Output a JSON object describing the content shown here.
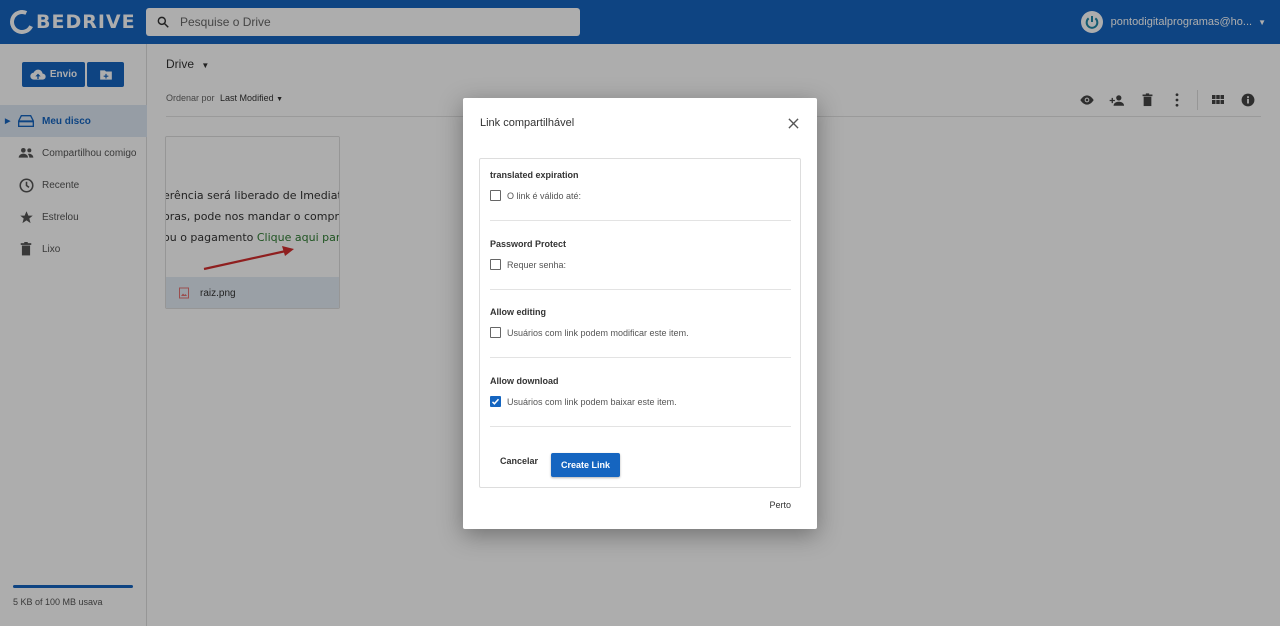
{
  "brand": {
    "name": "BEDRIVE",
    "accent": "#1565c0"
  },
  "search": {
    "placeholder": "Pesquise o Drive"
  },
  "account": {
    "email": "pontodigitalprogramas@ho..."
  },
  "sidebar": {
    "upload_label": "Envio",
    "items": [
      {
        "label": "Meu disco",
        "icon": "drive-icon",
        "active": true
      },
      {
        "label": "Compartilhou comigo",
        "icon": "people-icon"
      },
      {
        "label": "Recente",
        "icon": "clock-icon"
      },
      {
        "label": "Estrelou",
        "icon": "star-icon"
      },
      {
        "label": "Lixo",
        "icon": "trash-icon"
      }
    ],
    "storage_text": "5 KB of 100 MB usava"
  },
  "main": {
    "breadcrumb": "Drive",
    "sort_label": "Ordenar por",
    "sort_value": "Last Modified",
    "file": {
      "name": "raiz.png",
      "preview_lines": [
        "erência será liberado de Imediato, c",
        "oras, pode nos mandar o comprova",
        "ou o pagamento ",
        "Clique aqui para"
      ]
    }
  },
  "modal": {
    "title": "Link compartilhável",
    "sections": [
      {
        "label": "translated expiration",
        "option": "O link é válido até:",
        "checked": false
      },
      {
        "label": "Password Protect",
        "option": "Requer senha:",
        "checked": false
      },
      {
        "label": "Allow editing",
        "option": "Usuários com link podem modificar este item.",
        "checked": false
      },
      {
        "label": "Allow download",
        "option": "Usuários com link podem baixar este item.",
        "checked": true
      }
    ],
    "cancel_label": "Cancelar",
    "create_label": "Create Link",
    "close_label": "Perto"
  }
}
